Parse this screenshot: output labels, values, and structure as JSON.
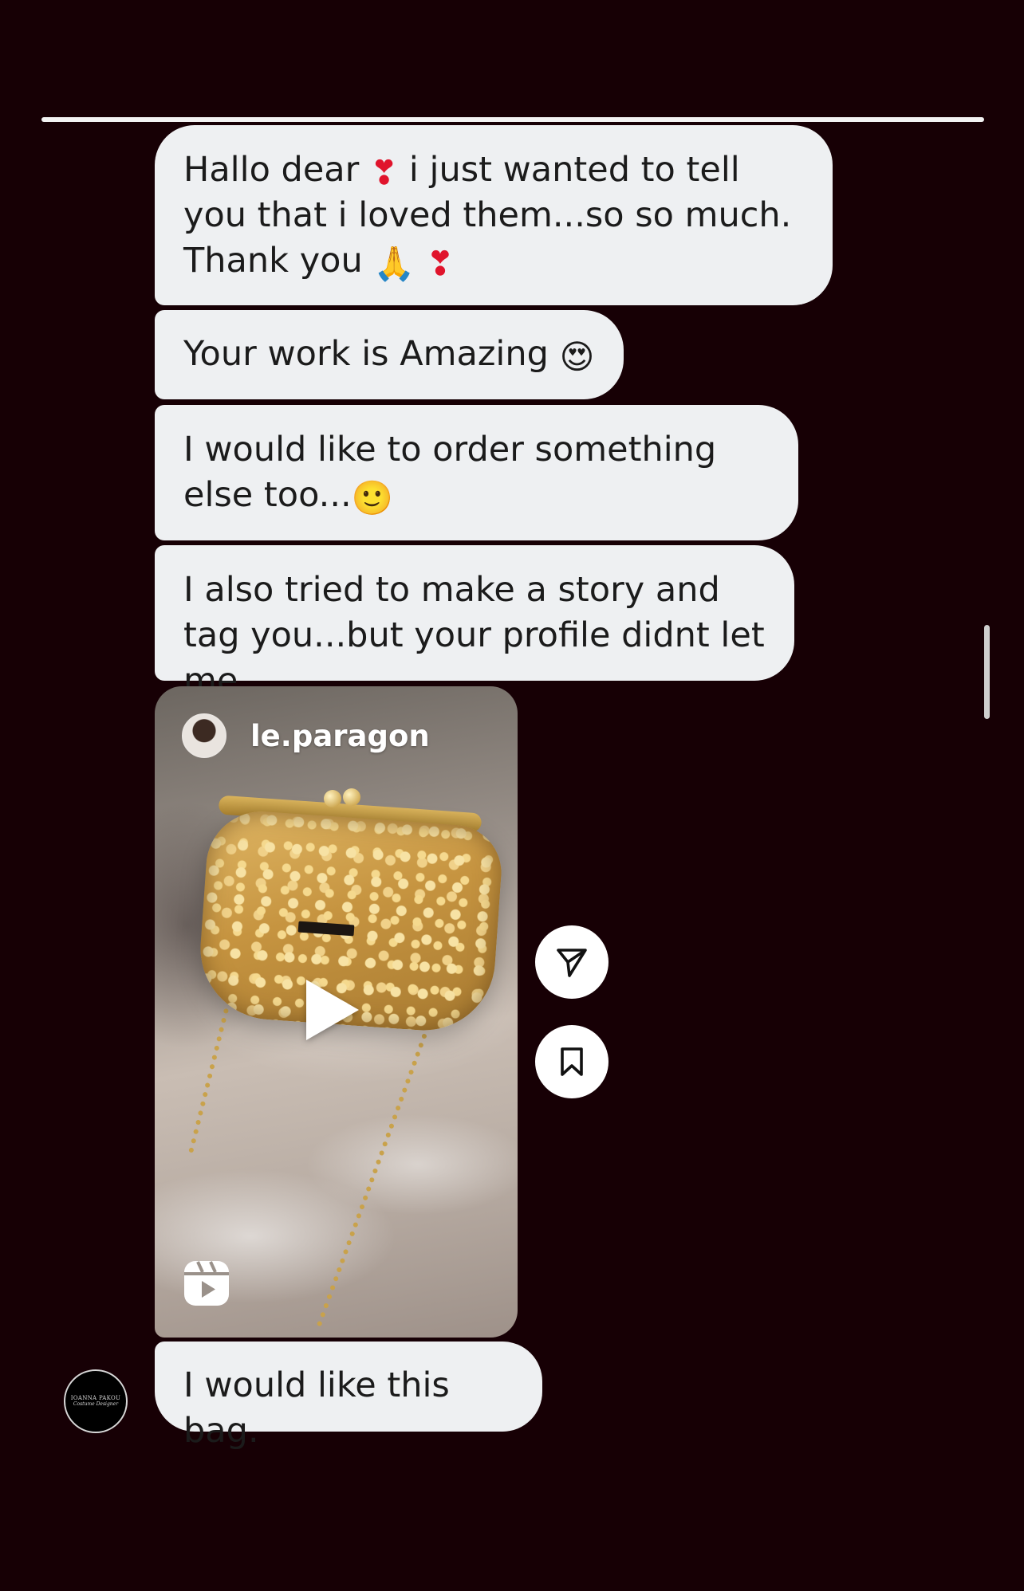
{
  "messages": [
    {
      "parts": [
        "Hallo dear ",
        "❣",
        "  i just wanted to tell you that i loved them...so so much. Thank you ",
        "🙏",
        " ",
        "❣"
      ]
    },
    {
      "parts": [
        "Your work is Amazing ",
        "😍"
      ]
    },
    {
      "parts": [
        "I would like to order something else too...",
        "🙂"
      ]
    },
    {
      "parts": [
        "I also tried to make a story and tag you...but your profile didnt let me...."
      ]
    },
    {
      "parts": [
        "I would like this bag."
      ]
    }
  ],
  "shared_reel": {
    "username": "le.paragon",
    "media_type": "reel",
    "icons": {
      "play": "play-icon",
      "reels": "reels-icon"
    }
  },
  "actions": {
    "send": "send-icon",
    "save": "bookmark-icon"
  },
  "sender": {
    "name_line1": "IOANNA PAKOU",
    "name_line2": "Costume Designer"
  },
  "colors": {
    "background": "#170005",
    "bubble": "#eef0f2",
    "text": "#1b1b1b"
  }
}
